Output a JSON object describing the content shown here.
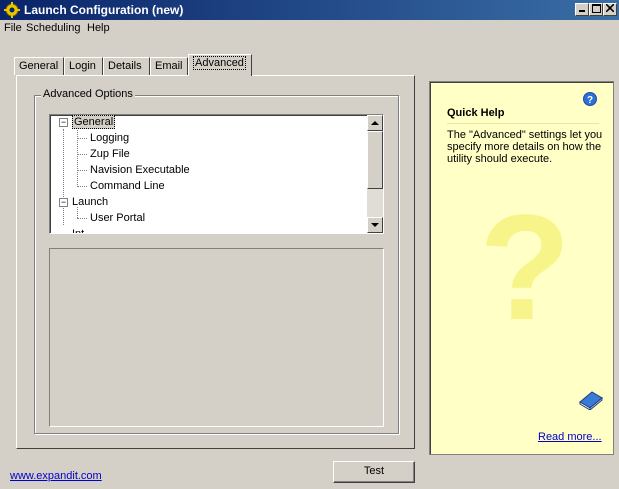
{
  "window": {
    "title": "Launch Configuration (new)"
  },
  "menu": {
    "items": [
      "File",
      "Scheduling",
      "Help"
    ]
  },
  "tabs": [
    "General",
    "Login",
    "Details",
    "Email",
    "Advanced"
  ],
  "active_tab": "Advanced",
  "advanced": {
    "group_label": "Advanced Options",
    "tree": [
      {
        "label": "General",
        "expander": "−",
        "selected": true,
        "children": [
          "Logging",
          "Zup File",
          "Navision Executable",
          "Command Line"
        ]
      },
      {
        "label": "Launch",
        "expander": "−",
        "children": [
          "User Portal"
        ]
      }
    ],
    "partial_item": "Int..."
  },
  "quick_help": {
    "title": "Quick Help",
    "text": "The \"Advanced\" settings let you specify more details on how the utility should execute.",
    "read_more": "Read more...",
    "help_icon": "question-circle-icon",
    "book_icon": "book-icon",
    "watermark": "?"
  },
  "footer": {
    "link": "www.expandit.com",
    "test_button": "Test"
  },
  "colors": {
    "title_bar": "#0a246a",
    "help_bg": "#ffffc6",
    "link": "#0000cc",
    "face": "#d4d0c8"
  }
}
